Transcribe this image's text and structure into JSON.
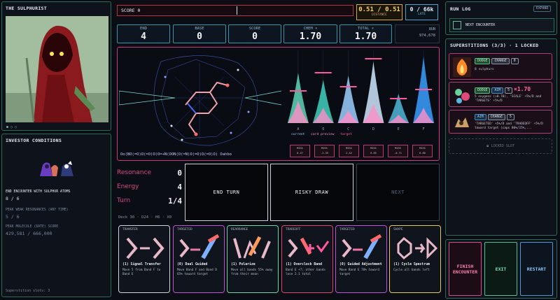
{
  "character": {
    "title": "THE SULPHURIST"
  },
  "investor": {
    "title": "INVESTOR CONDITIONS",
    "conditions": [
      {
        "label": "END ENCOUNTER WITH SULPHUR ATOMS",
        "value": "8 / 6",
        "active": true
      },
      {
        "label": "PEAK WEAK RESONANCES (ANY TIME)",
        "value": "5 / 6",
        "active": false
      },
      {
        "label": "PEAK MOLECULE (DATE) SCORE",
        "value": "429,581 / 666,000",
        "active": false
      }
    ],
    "slots": "Superstition slots: 3"
  },
  "topbar": {
    "score_label": "SCORE 0",
    "distance_value": "0.51 / 0.51",
    "distance_label": "DISTANCE",
    "late_value": "0 / 66k",
    "late_label": "LATE"
  },
  "stats": [
    {
      "label": "END",
      "value": "4"
    },
    {
      "label": "BASE",
      "value": "0"
    },
    {
      "label": "SCORE",
      "value": "0"
    },
    {
      "label": "CHEM ×",
      "value": "1.70"
    },
    {
      "label": "TOTAL ×",
      "value": "1.70"
    }
  ],
  "run": {
    "label": "RUN",
    "value": "974,678"
  },
  "molecule": {
    "smiles": "Oo(NO(=O)O(=O)O(O=+N(OON(O(=N)O(=O)O(=O)O) Oahbo"
  },
  "spectrum": {
    "letters": [
      "A",
      "O",
      "C",
      "D",
      "E",
      "F"
    ],
    "legend": [
      "current",
      "card preview",
      "target"
    ],
    "legend_colors": [
      "#9ad0ff",
      "#ff8fc8",
      "#ff5aa0"
    ],
    "peaks": [
      0.72,
      0.62,
      0.68,
      0.88,
      0.42,
      0.95
    ],
    "preview": [
      0.32,
      0.22,
      0.18,
      0.27,
      0.12,
      0.22
    ],
    "targets": [
      0.46,
      0.72,
      0.52,
      0.92,
      0.35,
      0.48
    ],
    "peak_colors": [
      "#5dd6b8",
      "#3fd0c0",
      "#9ad0ff",
      "#cfe6ff",
      "#4fb7d8",
      "#3aa0ff"
    ],
    "readouts": [
      {
        "label": "MISS",
        "value": "0.47"
      },
      {
        "label": "MISS",
        "value": "-2.35"
      },
      {
        "label": "MISS",
        "value": "2.42"
      },
      {
        "label": "MISS",
        "value": "0.85"
      },
      {
        "label": "MISS",
        "value": "-0.71"
      },
      {
        "label": "MISS",
        "value": "6.80"
      }
    ]
  },
  "counters": [
    {
      "label": "Resonance",
      "value": "0"
    },
    {
      "label": "Energy",
      "value": "4"
    },
    {
      "label": "Turn",
      "value": "1/4"
    }
  ],
  "deck": "Deck 30 · D24 · H6 · X0",
  "actions": {
    "end_turn": "END TURN",
    "risky_draw": "RISKY DRAW",
    "next": "NEXT"
  },
  "cards": [
    {
      "type": "TRANSFER",
      "name": "(1) Signal Transfer",
      "desc": "Move 5 from Band F to Band E",
      "border": "#cfd4dc",
      "icon": "transfer"
    },
    {
      "type": "TARGETED",
      "name": "(0) Dual Guided",
      "desc": "Move Band F and Band D 65% toward target",
      "border": "#c04fd8",
      "icon": "targeted"
    },
    {
      "type": "REARRANGE",
      "name": "(1) Polarize",
      "desc": "Move all bands 55% away from their mean",
      "border": "#6fd4a0",
      "icon": "rearrange"
    },
    {
      "type": "TRADEOFF",
      "name": "(1) Overclock Band",
      "desc": "Band E +7; other bands lose 2.1 total",
      "border": "#d8466f",
      "icon": "tradeoff"
    },
    {
      "type": "TARGETED",
      "name": "(0) Guided Adjustment",
      "desc": "Move Band E 70% toward target",
      "border": "#c04fd8",
      "icon": "targeted"
    },
    {
      "type": "SHAPE",
      "name": "(1) Cycle Spectrum",
      "desc": "Cycle all bands left",
      "border": "#e6c85a",
      "icon": "shape"
    }
  ],
  "runlog": {
    "title": "RUN LOG",
    "expand": "EXPAND",
    "next_encounter": "NEXT ENCOUNTER"
  },
  "superstitions": {
    "title": "SUPERSTITIONS (3/3) · 1 LOCKED",
    "items": [
      {
        "tags": [
          "DODGE",
          "CHANGE"
        ],
        "count": "0",
        "text": "8 sulphurs",
        "mult": ""
      },
      {
        "tags": [
          "DODGE",
          "AIM"
        ],
        "count": "5",
        "mult": "×1.70",
        "text": "5 oxygens (×0.70), 'SCALE' +5%/D and 'TARGETS' +5%/D"
      },
      {
        "tags": [
          "AIM",
          "CHANGE"
        ],
        "count": "5",
        "mult": "",
        "text": "'TARGETED' +5%/D and 'TRADEOFF' +5%/D toward target (caps 80%/15%,..."
      }
    ],
    "locked": "LOCKED SLOT"
  },
  "endbuttons": {
    "finish": "FINISH ENCOUNTER",
    "exit": "EXIT",
    "restart": "RESTART"
  }
}
